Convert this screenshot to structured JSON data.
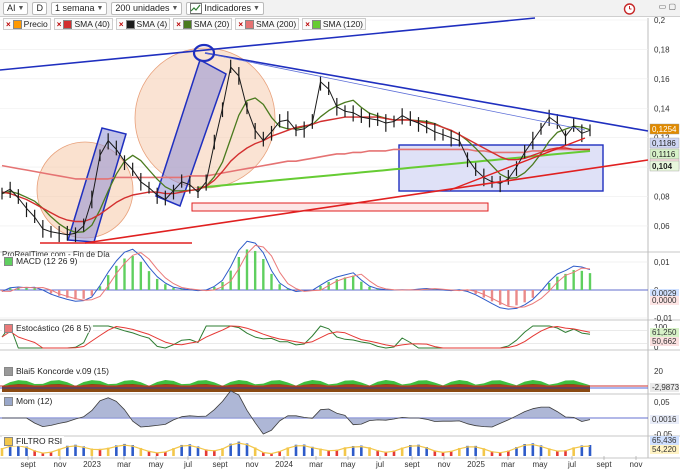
{
  "toolbar": {
    "symbol": "AI",
    "mode": "D",
    "period": "1 semana",
    "units": "200 unidades",
    "indicators_label": "Indicadores"
  },
  "legend": [
    {
      "label": "Precio",
      "color": "#ff9900"
    },
    {
      "label": "SMA (40)",
      "color": "#d32f2f"
    },
    {
      "label": "SMA (4)",
      "color": "#1a1a1a"
    },
    {
      "label": "SMA (20)",
      "color": "#4a7a1e"
    },
    {
      "label": "SMA (200)",
      "color": "#e57373"
    },
    {
      "label": "SMA (120)",
      "color": "#66cc33"
    }
  ],
  "credit": "ProRealTime.com - Fin de Día",
  "colors": {
    "price": "#1a1a1a",
    "sma40": "#d32f2f",
    "sma20": "#4a7a1e",
    "sma120": "#66cc33",
    "sma200": "#e57373",
    "trendline_blue": "#1f2fbf",
    "trendline_red": "#e02020",
    "macd_bar": "#5fcf5f",
    "macd_signal": "#ea7a7a",
    "circle_fill": "#f6c8a8"
  },
  "chart_data": [
    {
      "type": "line",
      "panel": "price",
      "x_ticks": [
        "sept",
        "nov",
        "2023",
        "mar",
        "may",
        "jul",
        "sept",
        "nov",
        "2024",
        "mar",
        "may",
        "jul",
        "sept",
        "nov",
        "2025",
        "mar",
        "may",
        "jul",
        "sept",
        "nov"
      ],
      "ylim": [
        0.045,
        0.2
      ],
      "y_ticks": [
        "0,2",
        "0,18",
        "0,16",
        "0,14",
        "0,12",
        "0,1",
        "0,08",
        "0,06"
      ],
      "last_labels": [
        "0,1254",
        "0,1186",
        "0,1116",
        "0,1066",
        "0,104"
      ],
      "series": [
        {
          "name": "Precio",
          "values": [
            0.082,
            0.085,
            0.079,
            0.072,
            0.066,
            0.058,
            0.056,
            0.055,
            0.054,
            0.055,
            0.06,
            0.078,
            0.108,
            0.118,
            0.112,
            0.104,
            0.098,
            0.09,
            0.086,
            0.081,
            0.078,
            0.084,
            0.09,
            0.088,
            0.083,
            0.09,
            0.116,
            0.14,
            0.168,
            0.162,
            0.14,
            0.125,
            0.118,
            0.124,
            0.131,
            0.132,
            0.125,
            0.126,
            0.13,
            0.158,
            0.153,
            0.141,
            0.138,
            0.137,
            0.134,
            0.133,
            0.132,
            0.13,
            0.131,
            0.135,
            0.132,
            0.13,
            0.127,
            0.124,
            0.122,
            0.12,
            0.118,
            0.106,
            0.098,
            0.093,
            0.09,
            0.089,
            0.092,
            0.1,
            0.11,
            0.118,
            0.126,
            0.134,
            0.13,
            0.121,
            0.128,
            0.123,
            0.125
          ]
        },
        {
          "name": "SMA (40)",
          "values": [
            0.083,
            0.082,
            0.08,
            0.078,
            0.075,
            0.072,
            0.069,
            0.066,
            0.064,
            0.063,
            0.063,
            0.065,
            0.068,
            0.072,
            0.076,
            0.079,
            0.081,
            0.082,
            0.083,
            0.083,
            0.082,
            0.082,
            0.083,
            0.084,
            0.085,
            0.087,
            0.091,
            0.097,
            0.104,
            0.109,
            0.113,
            0.116,
            0.118,
            0.121,
            0.123,
            0.125,
            0.127,
            0.128,
            0.129,
            0.131,
            0.132,
            0.133,
            0.134,
            0.134,
            0.134,
            0.134,
            0.134,
            0.133,
            0.132,
            0.132,
            0.132,
            0.131,
            0.13,
            0.129,
            0.127,
            0.125,
            0.122,
            0.119,
            0.116,
            0.113,
            0.11,
            0.107,
            0.105,
            0.105,
            0.106,
            0.108,
            0.11,
            0.112,
            0.113,
            0.113,
            0.112,
            0.112,
            0.112
          ]
        }
      ]
    },
    {
      "type": "bar",
      "panel": "MACD (12 26 9)",
      "ylim": [
        -0.01,
        0.01
      ],
      "y_ticks": [
        "0,01",
        "0",
        "-0,01"
      ],
      "last_labels": [
        "0,0029",
        "0,0000"
      ]
    },
    {
      "type": "line",
      "panel": "Estocástico (26 8 5)",
      "ylim": [
        0,
        100
      ],
      "y_ticks": [
        "100",
        "0"
      ],
      "last_labels": [
        "61,250",
        "50,662"
      ]
    },
    {
      "type": "area",
      "panel": "Blai5 Koncorde v.09 (15)",
      "y_ticks": [
        "20"
      ],
      "last_labels": [
        "-2,9873"
      ]
    },
    {
      "type": "area",
      "panel": "Mom (12)",
      "ylim": [
        -0.05,
        0.05
      ],
      "y_ticks": [
        "0,05",
        "0",
        "-0,05"
      ],
      "last_labels": [
        "0,0016"
      ]
    },
    {
      "type": "line",
      "panel": "FILTRO RSI",
      "last_labels": [
        "65,436",
        "54,220"
      ]
    }
  ],
  "panels": {
    "macd_title": "MACD (12 26 9)",
    "stoch_title": "Estocástico (26 8 5)",
    "konc_title": "Blai5 Koncorde v.09 (15)",
    "mom_title": "Mom (12)",
    "rsi_title": "FILTRO RSI"
  }
}
